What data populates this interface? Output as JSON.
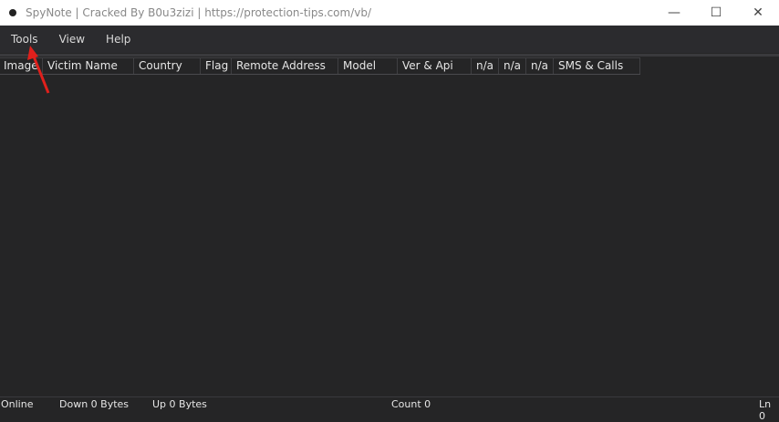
{
  "window": {
    "title": "SpyNote | Cracked By B0u3zizi | https://protection-tips.com/vb/",
    "minimize": "—",
    "maximize": "☐",
    "close": "✕"
  },
  "menu": [
    "Tools",
    "View",
    "Help"
  ],
  "columns": [
    "Image",
    "Victim Name",
    "Country",
    "Flag",
    "Remote Address",
    "Model",
    "Ver & Api",
    "n/a",
    "n/a",
    "n/a",
    "SMS & Calls"
  ],
  "status": {
    "online": "Online",
    "down": "Down 0 Bytes",
    "up": "Up 0 Bytes",
    "count": "Count 0",
    "ln": "Ln 0"
  },
  "colors": {
    "annotation_arrow": "#e0201c",
    "background": "#252526"
  }
}
